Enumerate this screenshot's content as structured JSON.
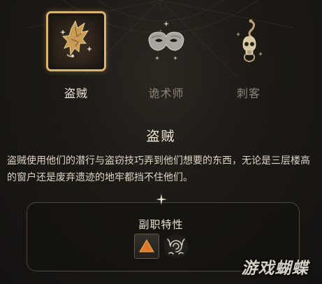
{
  "subclasses": [
    {
      "label": "盗贼",
      "icon": "thief-emblem-icon",
      "selected": true
    },
    {
      "label": "诡术师",
      "icon": "mask-emblem-icon",
      "selected": false
    },
    {
      "label": "刺客",
      "icon": "skull-serpent-emblem-icon",
      "selected": false
    }
  ],
  "selected": {
    "title": "盗贼",
    "description": "盗贼使用他们的潜行与盗窃技巧弄到他们想要的东西，无论是三层楼高的窗户还是废弃遗迹的地牢都挡不住他们。"
  },
  "traits": {
    "title": "副职特性",
    "items": [
      {
        "icon": "orange-triangle-trait-icon"
      },
      {
        "icon": "swirl-hands-trait-icon"
      }
    ]
  },
  "watermark": "游戏蝴蝶",
  "colors": {
    "accent_gold": "#d9b46b",
    "background": "#1c1915",
    "trait_orange": "#e07a2a"
  }
}
